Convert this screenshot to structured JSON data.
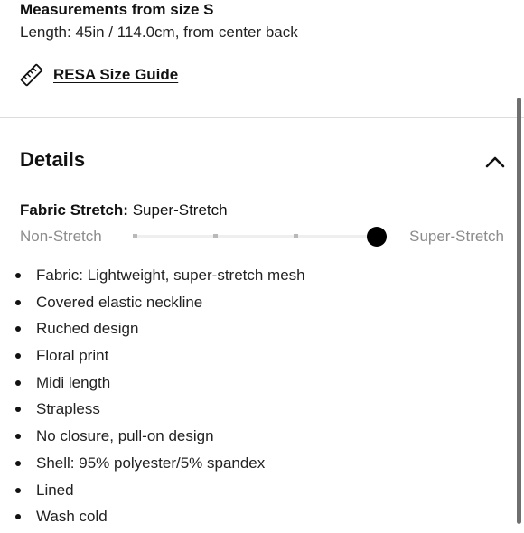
{
  "measurements": {
    "title": "Measurements from size S",
    "length": "Length: 45in / 114.0cm, from center back"
  },
  "size_guide": {
    "icon": "ruler-icon",
    "label": "RESA Size Guide"
  },
  "details": {
    "title": "Details",
    "toggle_icon": "chevron-up-icon",
    "fabric_stretch": {
      "label": "Fabric Stretch:",
      "value": "Super-Stretch",
      "scale_min": "Non-Stretch",
      "scale_max": "Super-Stretch",
      "level": 1.0
    },
    "bullets": [
      "Fabric: Lightweight, super-stretch mesh",
      "Covered elastic neckline",
      "Ruched design",
      "Floral print",
      "Midi length",
      "Strapless",
      "No closure, pull-on design",
      "Shell: 95% polyester/5% spandex",
      "Lined",
      "Wash cold"
    ]
  }
}
